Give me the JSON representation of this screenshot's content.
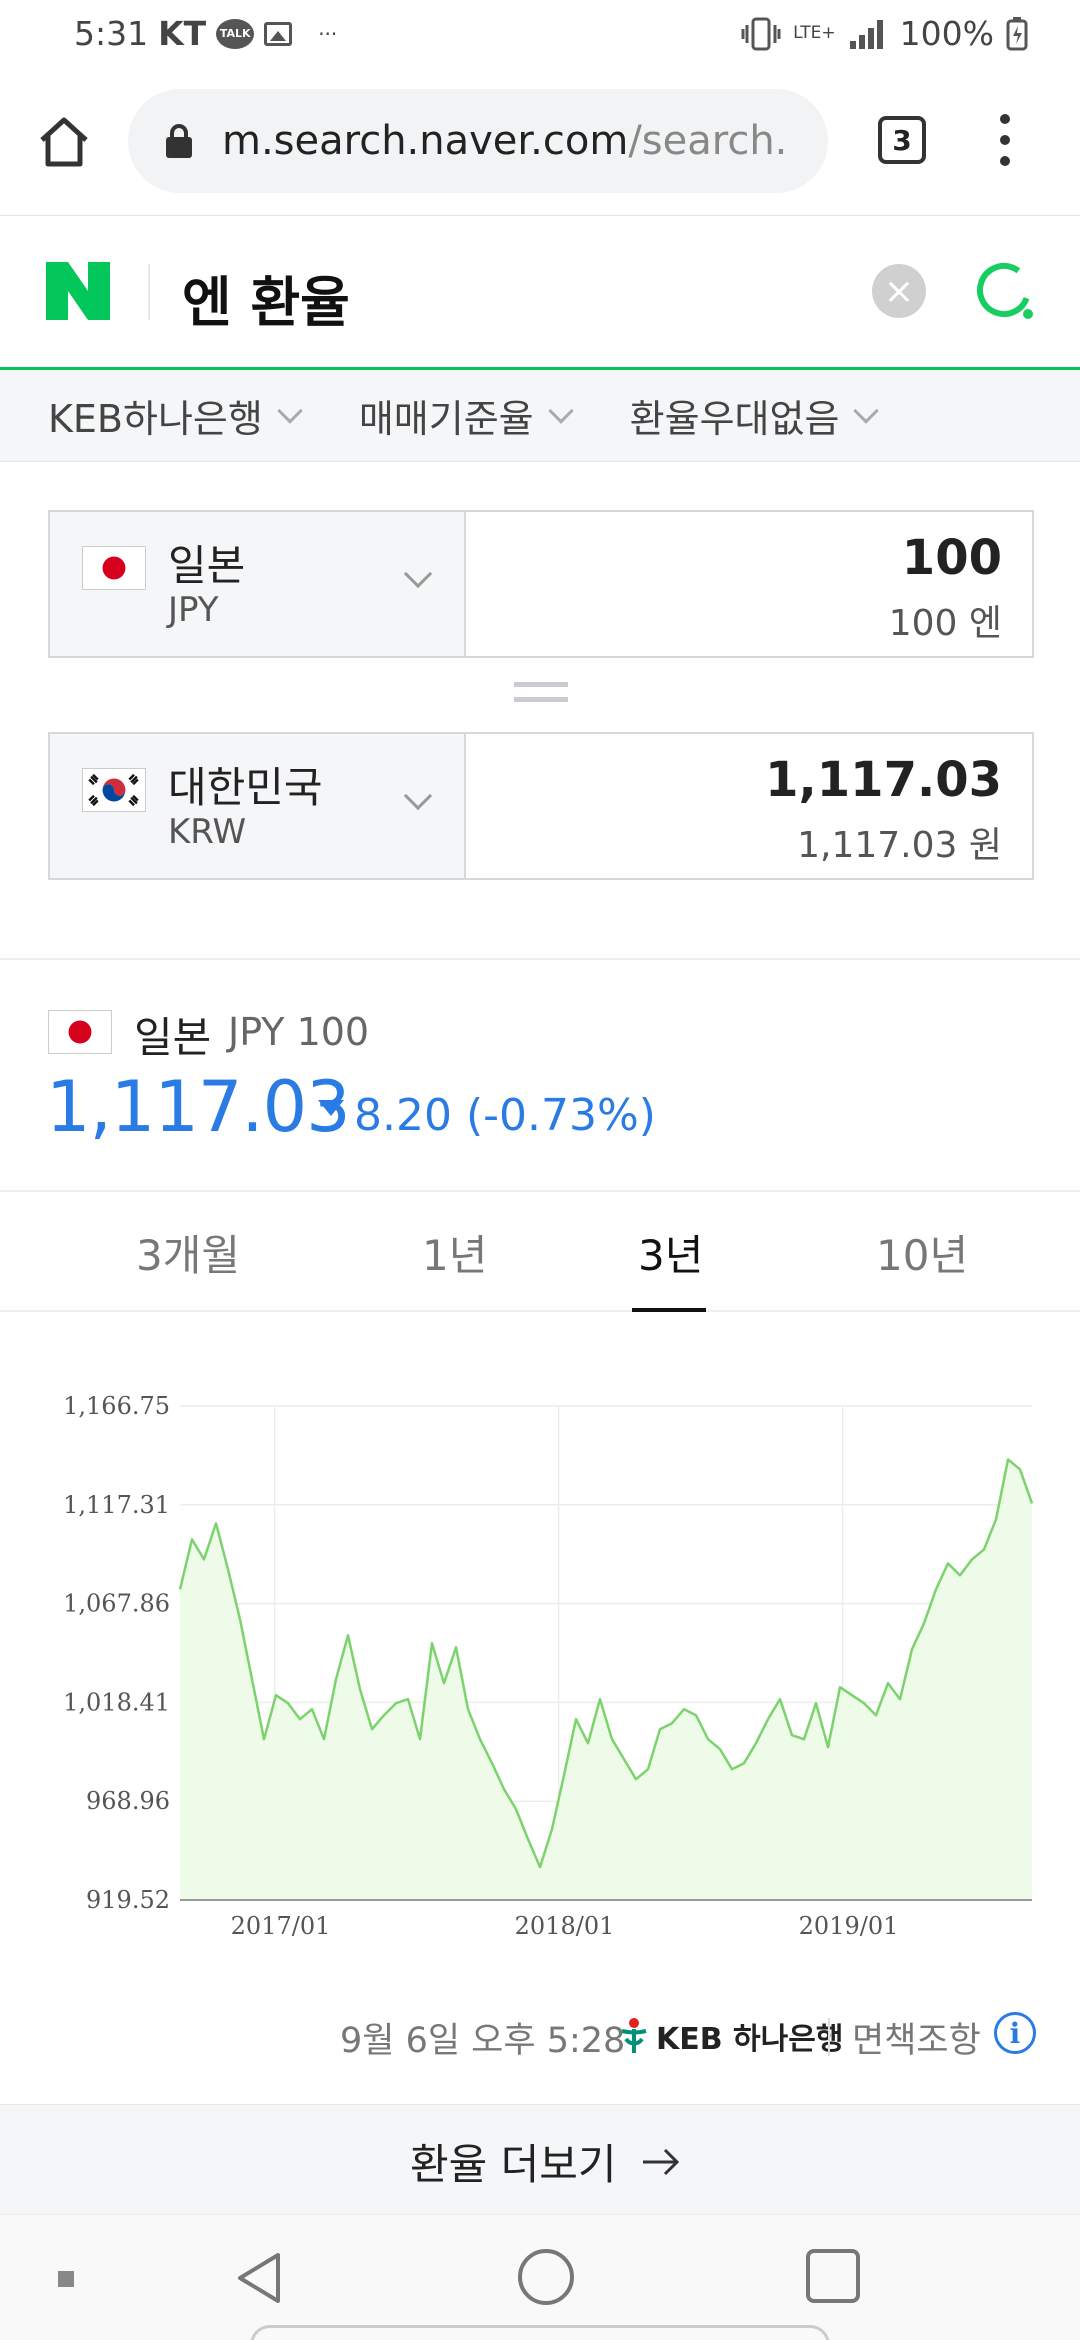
{
  "status": {
    "time": "5:31",
    "carrier": "KT",
    "talk_icon_text": "TALK",
    "more": "···",
    "network": "LTE+",
    "battery": "100%"
  },
  "browser": {
    "url_main": "m.search.naver.com",
    "url_dim": "/search.",
    "tab_count": "3"
  },
  "search": {
    "query": "엔 환율"
  },
  "filters": [
    {
      "label": "KEB하나은행"
    },
    {
      "label": "매매기준율"
    },
    {
      "label": "환율우대없음"
    }
  ],
  "converter": {
    "from": {
      "name": "일본",
      "code": "JPY",
      "amount": "100",
      "amount_text": "100 엔"
    },
    "to": {
      "name": "대한민국",
      "code": "KRW",
      "amount": "1,117.03",
      "amount_text": "1,117.03 원"
    }
  },
  "summary": {
    "country": "일본",
    "code": "JPY 100",
    "rate": "1,117.03",
    "change": "8.20 (-0.73%)",
    "direction": "down"
  },
  "period_tabs": [
    {
      "label": "3개월",
      "active": false
    },
    {
      "label": "1년",
      "active": false
    },
    {
      "label": "3년",
      "active": true
    },
    {
      "label": "10년",
      "active": false
    }
  ],
  "chart_data": {
    "type": "area",
    "title": "",
    "xlabel": "",
    "ylabel": "",
    "y_ticks": [
      "1,166.75",
      "1,117.31",
      "1,067.86",
      "1,018.41",
      "968.96",
      "919.52"
    ],
    "x_ticks": [
      "2017/01",
      "2018/01",
      "2019/01"
    ],
    "ylim": [
      919.52,
      1166.75
    ],
    "x_range": [
      "2016-09",
      "2019-09"
    ],
    "grid": true,
    "series": [
      {
        "line_color": "#7cd36e",
        "fill_color": "#edfbe8",
        "x": [
          "2016-09",
          "2016-10",
          "2016-10",
          "2016-11",
          "2016-11",
          "2016-12",
          "2016-12",
          "2017-01",
          "2017-01",
          "2017-02",
          "2017-02",
          "2017-03",
          "2017-03",
          "2017-04",
          "2017-04",
          "2017-05",
          "2017-05",
          "2017-06",
          "2017-06",
          "2017-07",
          "2017-07",
          "2017-08",
          "2017-08",
          "2017-09",
          "2017-09",
          "2017-10",
          "2017-10",
          "2017-11",
          "2017-11",
          "2017-12",
          "2017-12",
          "2018-01",
          "2018-01",
          "2018-02",
          "2018-02",
          "2018-03",
          "2018-03",
          "2018-04",
          "2018-04",
          "2018-05",
          "2018-05",
          "2018-06",
          "2018-06",
          "2018-07",
          "2018-07",
          "2018-08",
          "2018-08",
          "2018-09",
          "2018-09",
          "2018-10",
          "2018-10",
          "2018-11",
          "2018-11",
          "2018-12",
          "2018-12",
          "2019-01",
          "2019-01",
          "2019-02",
          "2019-02",
          "2019-03",
          "2019-03",
          "2019-04",
          "2019-04",
          "2019-05",
          "2019-05",
          "2019-06",
          "2019-06",
          "2019-07",
          "2019-07",
          "2019-08",
          "2019-08",
          "2019-09"
        ],
        "values": [
          1075,
          1100,
          1090,
          1108,
          1085,
          1060,
          1030,
          1000,
          1022,
          1018,
          1010,
          1015,
          1000,
          1030,
          1052,
          1025,
          1005,
          1012,
          1018,
          1020,
          1000,
          1048,
          1028,
          1046,
          1015,
          1000,
          988,
          975,
          965,
          950,
          936,
          955,
          982,
          1010,
          998,
          1020,
          1000,
          990,
          980,
          985,
          1005,
          1008,
          1015,
          1012,
          1000,
          995,
          985,
          988,
          998,
          1010,
          1020,
          1002,
          1000,
          1018,
          996,
          1026,
          1022,
          1018,
          1012,
          1028,
          1020,
          1045,
          1058,
          1075,
          1088,
          1082,
          1090,
          1095,
          1110,
          1140,
          1135,
          1118
        ]
      }
    ]
  },
  "footer": {
    "timestamp": "9월 6일 오후 5:28",
    "bank": "KEB 하나은행",
    "disclaimer": "면책조항",
    "info": "i"
  },
  "more_button": {
    "label": "환율 더보기"
  }
}
